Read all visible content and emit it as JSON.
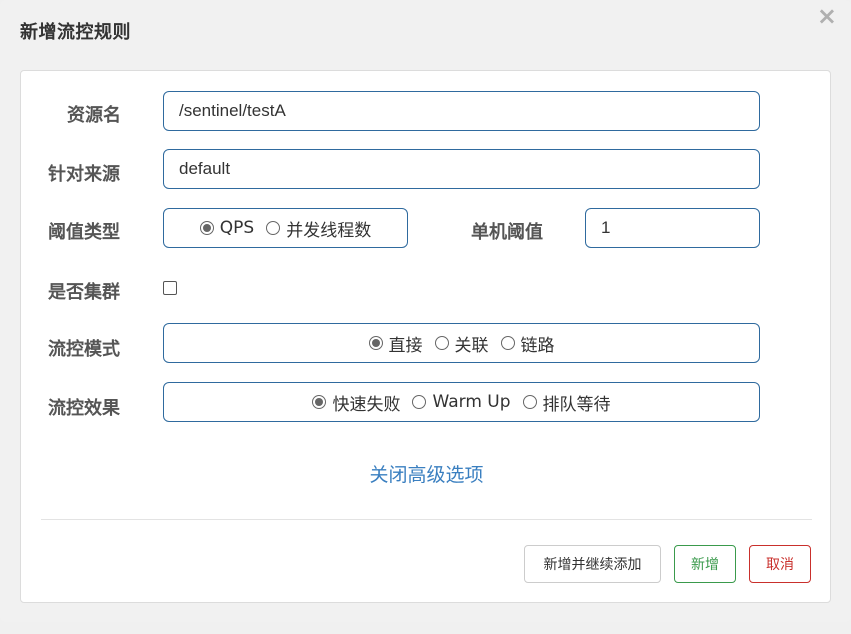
{
  "dialog": {
    "title": "新增流控规则",
    "close_symbol": "×"
  },
  "form": {
    "resource_name": {
      "label": "资源名",
      "value": "/sentinel/testA"
    },
    "limit_app": {
      "label": "针对来源",
      "value": "default"
    },
    "threshold_type": {
      "label": "阈值类型",
      "options": [
        {
          "label": "QPS",
          "checked": true
        },
        {
          "label": "并发线程数",
          "checked": false
        }
      ]
    },
    "single_threshold": {
      "label": "单机阈值",
      "value": "1"
    },
    "cluster_mode": {
      "label": "是否集群",
      "checked": false
    },
    "strategy": {
      "label": "流控模式",
      "options": [
        {
          "label": "直接",
          "checked": true
        },
        {
          "label": "关联",
          "checked": false
        },
        {
          "label": "链路",
          "checked": false
        }
      ]
    },
    "control_behavior": {
      "label": "流控效果",
      "options": [
        {
          "label": "快速失败",
          "checked": true
        },
        {
          "label": "Warm Up",
          "checked": false
        },
        {
          "label": "排队等待",
          "checked": false
        }
      ]
    },
    "advanced_link": "关闭高级选项"
  },
  "footer": {
    "continue_label": "新增并继续添加",
    "add_label": "新增",
    "cancel_label": "取消"
  },
  "colors": {
    "input_border": "#2f6a9e",
    "link": "#3a7fc0",
    "success": "#3a9a4c",
    "danger": "#c9302c"
  }
}
